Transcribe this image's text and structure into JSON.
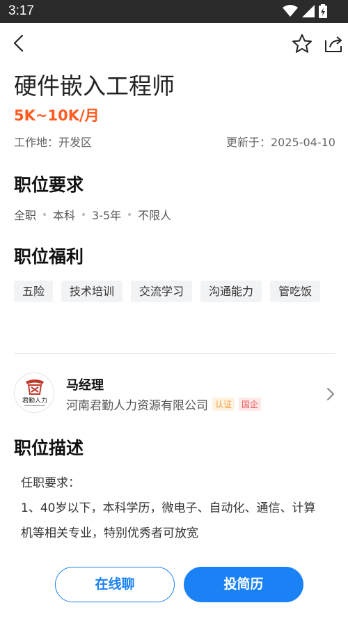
{
  "status_bar": {
    "time": "3:17"
  },
  "job": {
    "title": "硬件嵌入工程师",
    "salary": "5K~10K/月",
    "location": "工作地：开发区",
    "updated": "更新于：2025-04-10"
  },
  "requirements": {
    "heading": "职位要求",
    "items": [
      "全职",
      "本科",
      "3-5年",
      "不限人"
    ]
  },
  "benefits": {
    "heading": "职位福利",
    "tags": [
      "五险",
      "技术培训",
      "交流学习",
      "沟通能力",
      "管吃饭"
    ]
  },
  "recruiter": {
    "name": "马经理",
    "company": "河南君勤人力资源有限公司",
    "badge_cert": "认证",
    "badge_soe": "国企",
    "logo_text": "君勤人力"
  },
  "description": {
    "heading": "职位描述",
    "lines": [
      "任职要求：",
      "1、40岁以下，本科学历，微电子、自动化、通信、计算机等相关专业，特别优秀者可放宽"
    ]
  },
  "actions": {
    "chat": "在线聊",
    "apply": "投简历"
  },
  "colors": {
    "accent": "#1a82f5",
    "salary": "#ff5a1f"
  }
}
